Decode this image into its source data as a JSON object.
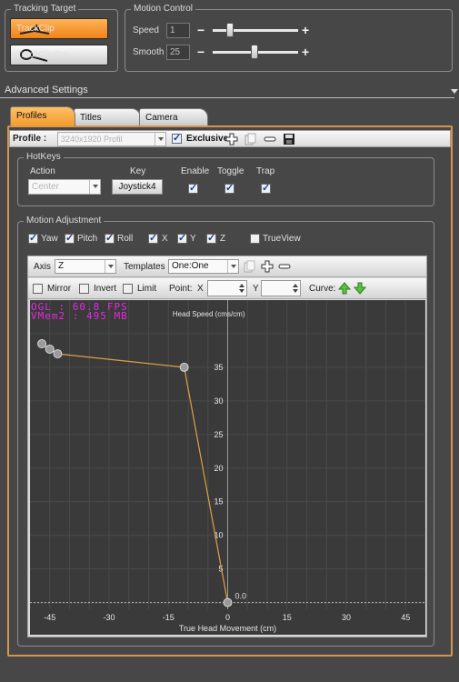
{
  "tracking_target": {
    "title": "Tracking Target",
    "buttons": [
      {
        "label": "TrackClip",
        "icon": "trackclip-icon",
        "active": true
      },
      {
        "label": "TrackClipPro",
        "icon": "trackclippro-icon",
        "active": false
      }
    ]
  },
  "motion_control": {
    "title": "Motion Control",
    "speed": {
      "label": "Speed",
      "value": "1",
      "slider_fraction": 0.2
    },
    "smooth": {
      "label": "Smooth",
      "value": "25",
      "slider_fraction": 0.49
    }
  },
  "advanced": {
    "title": "Advanced Settings"
  },
  "tabs": [
    {
      "label": "Profiles",
      "active": true
    },
    {
      "label": "Titles",
      "active": false
    },
    {
      "label": "Camera",
      "active": false
    }
  ],
  "profile_bar": {
    "label": "Profile :",
    "combo_value": "3240x1920 Profil",
    "exclusive_label": "Exclusive",
    "exclusive_checked": true
  },
  "hotkeys": {
    "title": "HotKeys",
    "action_label": "Action",
    "key_label": "Key",
    "enable_label": "Enable",
    "toggle_label": "Toggle",
    "trap_label": "Trap",
    "action_value": "Center",
    "key_value": "Joystick4",
    "enable_checked": true,
    "toggle_checked": true,
    "trap_checked": true
  },
  "motion_adjustment": {
    "title": "Motion Adjustment",
    "axes": [
      {
        "label": "Yaw",
        "checked": true
      },
      {
        "label": "Pitch",
        "checked": true
      },
      {
        "label": "Roll",
        "checked": true
      },
      {
        "label": "X",
        "checked": true
      },
      {
        "label": "Y",
        "checked": true
      },
      {
        "label": "Z",
        "checked": true
      },
      {
        "label": "TrueView",
        "checked": false
      }
    ]
  },
  "graph_toolbar": {
    "axis_label": "Axis",
    "axis_value": "Z",
    "templates_label": "Templates",
    "templates_value": "One:One",
    "mirror_label": "Mirror",
    "invert_label": "Invert",
    "limit_label": "Limit",
    "point_label": "Point:",
    "x_label": "X",
    "y_label": "Y",
    "curve_label": "Curve:"
  },
  "overlay": {
    "line1": "OGL   :  60.8 FPS",
    "line2": "VMem2 :  495 MB"
  },
  "chart_data": {
    "type": "line",
    "xlabel": "True Head Movement (cm)",
    "ylabel": "Head Speed (cms/cm)",
    "xlim": [
      -50,
      50
    ],
    "ylim": [
      -1,
      45
    ],
    "xticks": [
      -45,
      -30,
      -15,
      0,
      15,
      30,
      45
    ],
    "yticks": [
      0,
      5,
      10,
      15,
      20,
      25,
      30,
      35
    ],
    "zero_annotation": "0.0",
    "series": [
      {
        "color": "#e0a040",
        "points": [
          [
            -47,
            38.5
          ],
          [
            -45,
            37.7
          ],
          [
            -43,
            37.0
          ],
          [
            -11,
            35.0
          ],
          [
            0,
            0
          ]
        ]
      }
    ]
  }
}
